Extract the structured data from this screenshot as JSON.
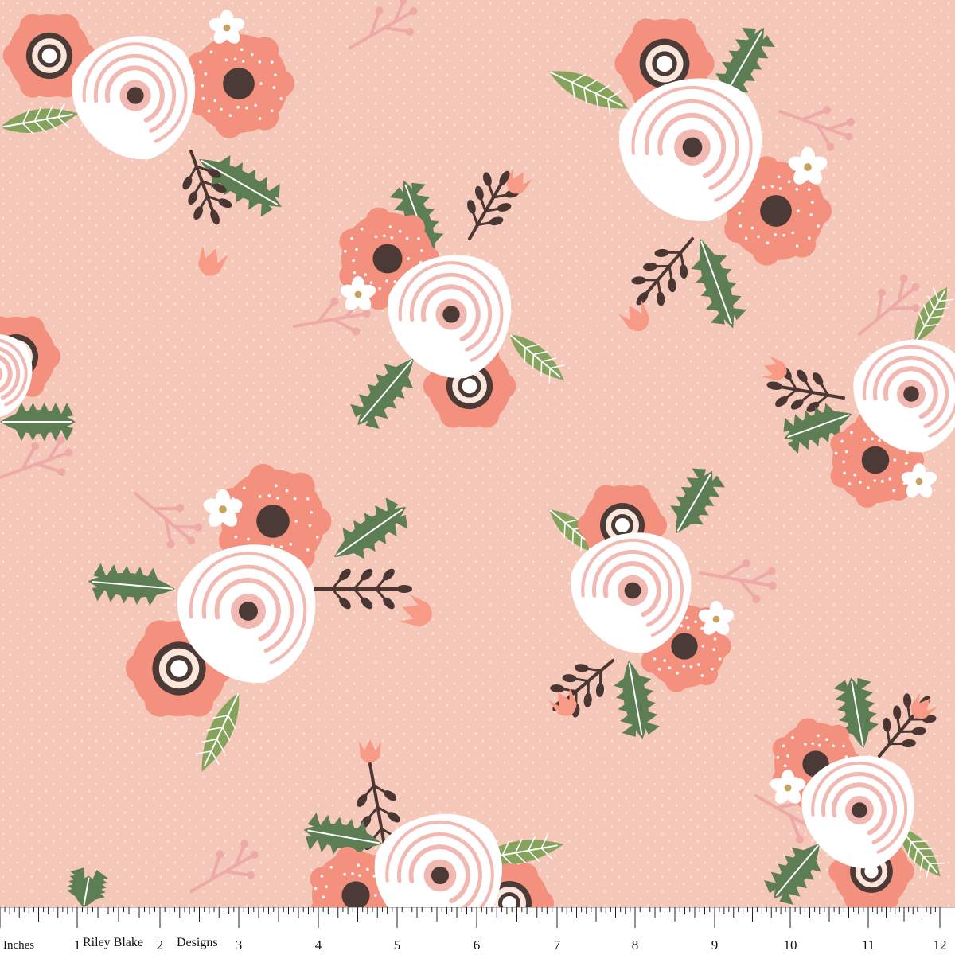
{
  "fabric": {
    "colors": {
      "background": "#f4c7b8",
      "dots": "#fbe1d6",
      "sprig": "#eeaaa7",
      "white_rose": "#ffffff",
      "rose_line": "#f2b9b2",
      "rose_center": "#4b3a35",
      "coral": "#f3907e",
      "coral_dots": "#ffffff",
      "bud": "#f79a86",
      "leaf_dark": "#5d7d54",
      "leaf_light": "#86a35d",
      "stem": "#4a3632",
      "daisy": "#ffffff",
      "daisy_center": "#c9a25c"
    }
  },
  "ruler": {
    "unit_label": "Inches",
    "maker_name_part1": "Riley Blake",
    "maker_name_part2": "Designs",
    "numbers": [
      "1",
      "2",
      "3",
      "4",
      "5",
      "6",
      "7",
      "8",
      "9",
      "10",
      "11",
      "12"
    ]
  }
}
